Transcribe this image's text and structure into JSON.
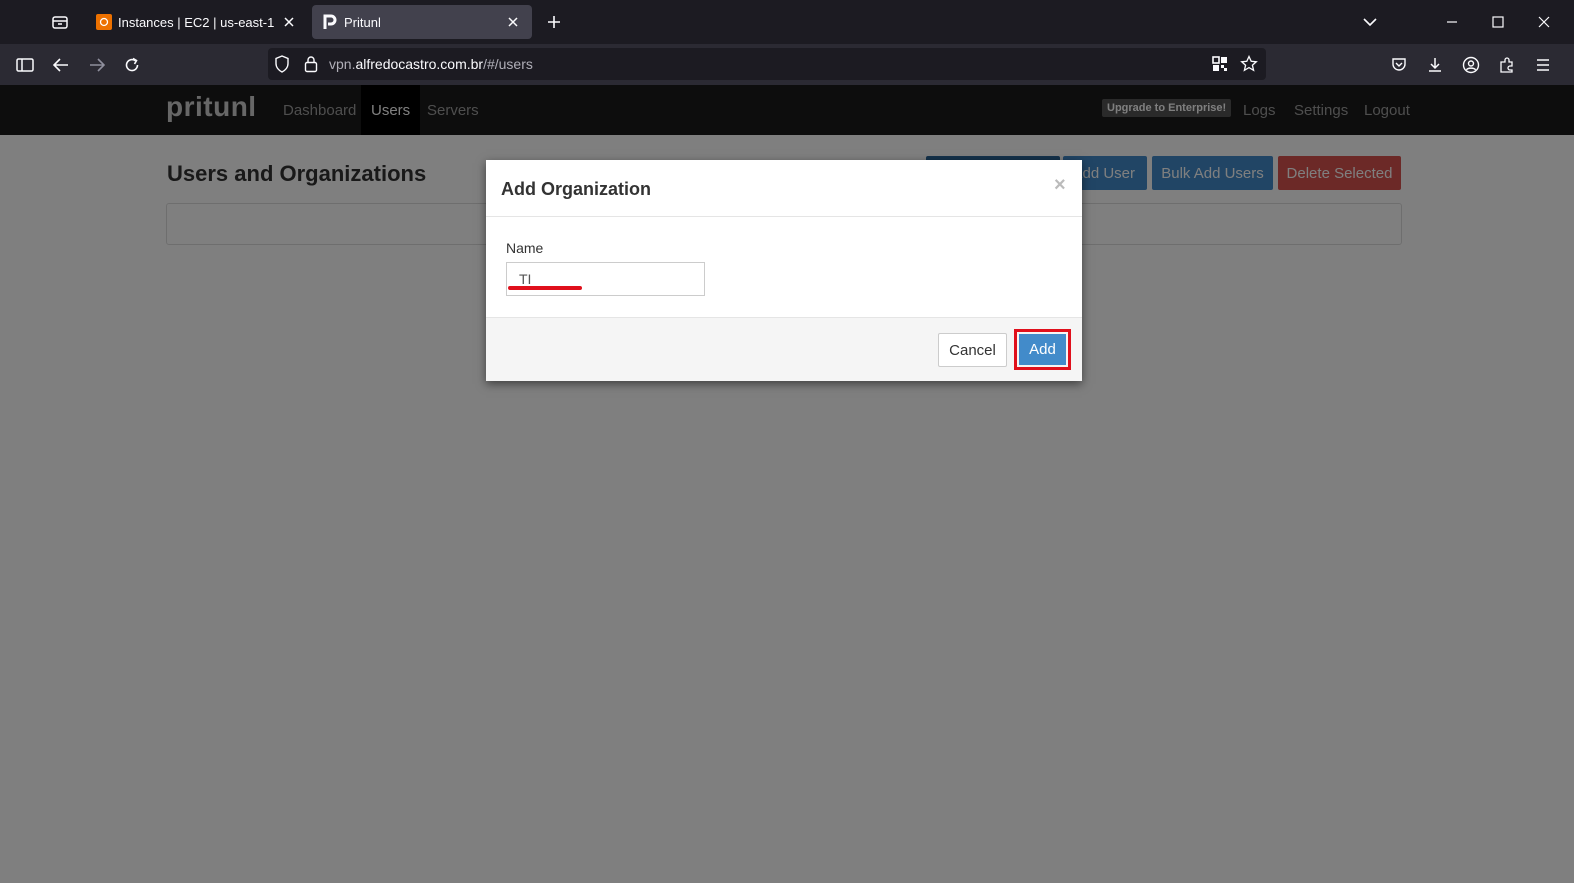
{
  "browser": {
    "tabs": [
      {
        "title": "Instances | EC2 | us-east-1",
        "active": false
      },
      {
        "title": "Pritunl",
        "active": true
      }
    ],
    "url": {
      "prefix": "vpn.",
      "host": "alfredocastro.com.br",
      "path": "/#/users"
    }
  },
  "app": {
    "brand": "pritunl",
    "nav": {
      "dashboard": "Dashboard",
      "users": "Users",
      "servers": "Servers"
    },
    "upgrade_badge": "Upgrade to Enterprise!",
    "right_nav": {
      "logs": "Logs",
      "settings": "Settings",
      "logout": "Logout"
    }
  },
  "users_page": {
    "title": "Users and Organizations",
    "buttons": {
      "add_user": "Add User",
      "bulk_add_users": "Bulk Add Users",
      "delete_selected": "Delete Selected"
    }
  },
  "modal": {
    "title": "Add Organization",
    "close": "×",
    "name_label": "Name",
    "name_value": "TI",
    "cancel": "Cancel",
    "add": "Add"
  },
  "colors": {
    "primary": "#428bca",
    "danger": "#d9534f",
    "highlight": "#e0101c"
  }
}
